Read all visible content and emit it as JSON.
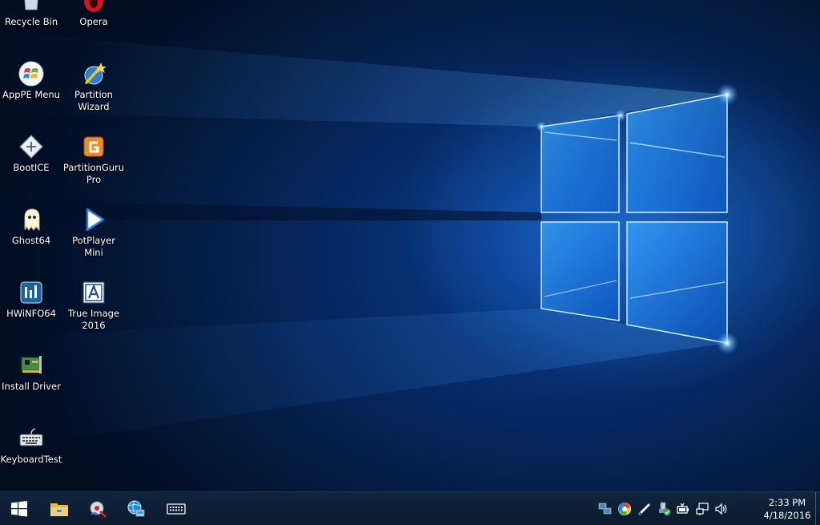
{
  "desktop": {
    "icons": [
      {
        "label": "Recycle Bin"
      },
      {
        "label": "Opera"
      },
      {
        "label": "AppPE Menu"
      },
      {
        "label": "Partition\nWizard"
      },
      {
        "label": "BootICE"
      },
      {
        "label": "PartitionGuru\nPro"
      },
      {
        "label": "Ghost64"
      },
      {
        "label": "PotPlayer\nMini"
      },
      {
        "label": "HWiNFO64"
      },
      {
        "label": "True Image\n2016"
      },
      {
        "label": "Install Driver"
      },
      {
        "label": "KeyboardTest"
      }
    ]
  },
  "taskbar": {
    "start_icon": "windows-logo-icon",
    "pinned": [
      {
        "icon": "file-explorer-icon"
      },
      {
        "icon": "disk-tool-icon"
      },
      {
        "icon": "network-globe-icon"
      },
      {
        "icon": "keyboard-icon"
      }
    ],
    "tray": [
      {
        "icon": "network-computers-icon"
      },
      {
        "icon": "color-wheel-icon"
      },
      {
        "icon": "pen-icon"
      },
      {
        "icon": "usb-safe-remove-icon"
      },
      {
        "icon": "battery-icon"
      },
      {
        "icon": "network-icon"
      },
      {
        "icon": "volume-icon"
      }
    ],
    "clock": {
      "time": "2:33 PM",
      "date": "4/18/2016"
    }
  },
  "colors": {
    "taskbar": "#0b1a2d",
    "wallpaper_glow": "#2f8cff",
    "wallpaper_dark": "#031633"
  }
}
